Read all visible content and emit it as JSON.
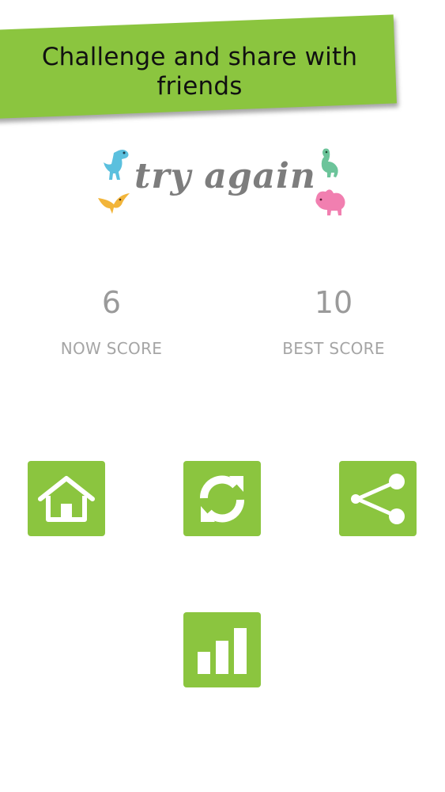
{
  "banner": {
    "text": "Challenge and share with friends"
  },
  "logo": {
    "text": "try again"
  },
  "scores": {
    "now": {
      "value": "6",
      "label": "NOW SCORE"
    },
    "best": {
      "value": "10",
      "label": "BEST SCORE"
    }
  },
  "buttons": {
    "home": {
      "icon": "home-icon"
    },
    "restart": {
      "icon": "refresh-icon"
    },
    "share": {
      "icon": "share-icon"
    },
    "leaderboard": {
      "icon": "bar-chart-icon"
    }
  },
  "colors": {
    "accent": "#8bc53f",
    "text_gray": "#9a9a9a"
  }
}
